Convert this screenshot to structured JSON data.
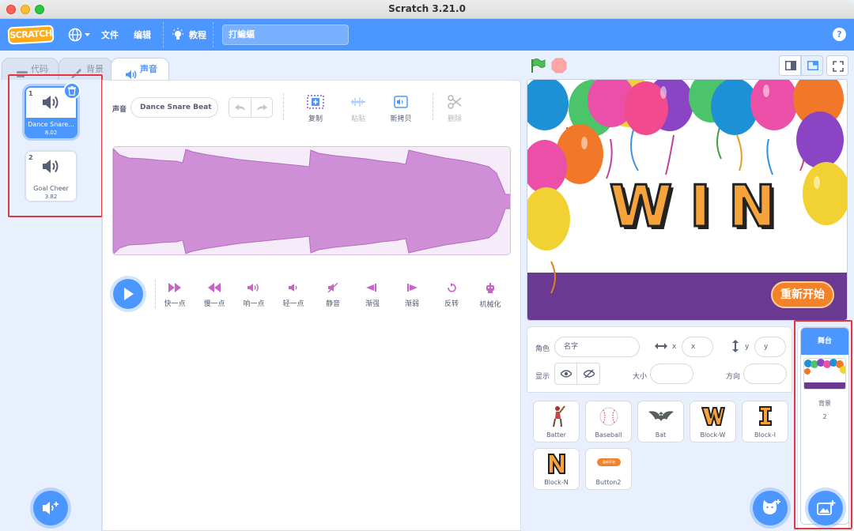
{
  "window": {
    "title": "Scratch 3.21.0"
  },
  "menubar": {
    "logo": "SCRATCH",
    "file": "文件",
    "edit": "编辑",
    "tutorials": "教程",
    "project_title": "打蝙蝠",
    "help": "?"
  },
  "tabs": {
    "code": "代码",
    "backdrops": "背景",
    "sounds": "声音"
  },
  "sounds": [
    {
      "index": "1",
      "name": "Dance Snare...",
      "duration": "8.02",
      "selected": true
    },
    {
      "index": "2",
      "name": "Goal Cheer",
      "duration": "3.82",
      "selected": false
    }
  ],
  "editor": {
    "sound_label": "声音",
    "sound_name": "Dance Snare Beat",
    "tools": {
      "copy": "复制",
      "paste": "粘贴",
      "copy_to_new": "新拷贝",
      "delete": "删除"
    },
    "effects": {
      "faster": "快一点",
      "slower": "慢一点",
      "louder": "响一点",
      "softer": "轻一点",
      "mute": "静音",
      "fade_in": "渐强",
      "fade_out": "渐弱",
      "reverse": "反转",
      "robot": "机械化"
    }
  },
  "stage": {
    "win_text": "WIN",
    "restart_label": "重新开始"
  },
  "sprite_info": {
    "sprite_label": "角色",
    "name_placeholder": "名字",
    "x_label": "x",
    "x_placeholder": "x",
    "y_label": "y",
    "y_placeholder": "y",
    "show_label": "显示",
    "size_label": "大小",
    "direction_label": "方向"
  },
  "sprites": [
    {
      "name": "Batter"
    },
    {
      "name": "Baseball"
    },
    {
      "name": "Bat"
    },
    {
      "name": "Block-W"
    },
    {
      "name": "Block-I"
    },
    {
      "name": "Block-N"
    },
    {
      "name": "Button2",
      "thumb_text": "重新开始"
    }
  ],
  "stage_target": {
    "header": "舞台",
    "backdrops_label": "背景",
    "backdrops_count": "2"
  },
  "colors": {
    "accent": "#4c97ff",
    "highlight_box": "#e0383e",
    "waveform": "#cf8fd6",
    "stage_band": "#6a3a92",
    "restart_button": "#f3832b"
  }
}
